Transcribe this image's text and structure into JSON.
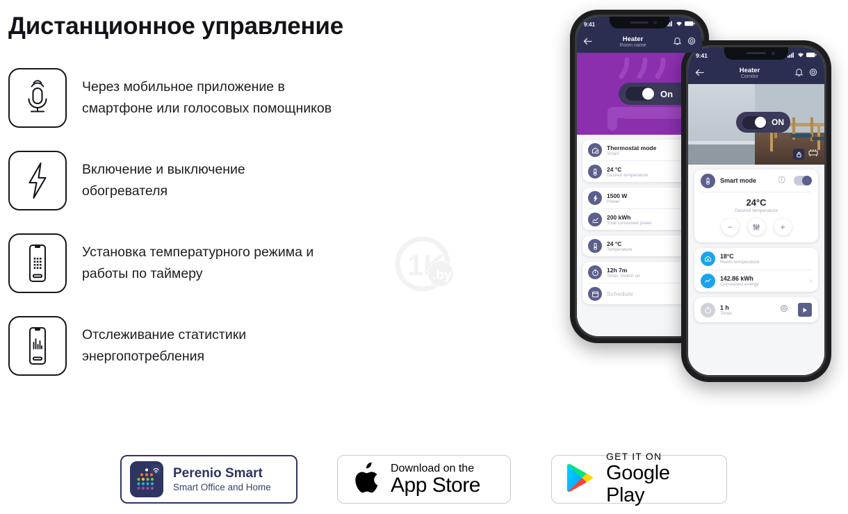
{
  "page": {
    "title": "Дистанционное управление",
    "watermark_logo": "1K.by",
    "watermark_url": "www.1k.by",
    "bg": "#ffffff"
  },
  "features": [
    {
      "icon": "microphone-icon",
      "line1": "Через мобильное приложение в",
      "line2": "смартфоне или голосовых помощников"
    },
    {
      "icon": "lightning-bolt-icon",
      "line1": "Включение и выключение",
      "line2": "обогревателя"
    },
    {
      "icon": "smartphone-keypad-icon",
      "line1": "Установка температурного режима и",
      "line2": "работы по таймеру"
    },
    {
      "icon": "smartphone-chart-icon",
      "line1": "Отслеживание статистики",
      "line2": "энергопотребления"
    }
  ],
  "phone_back": {
    "status": {
      "time": "9:41",
      "signal": "signal-bars-icon",
      "wifi": "wifi-icon",
      "battery": "battery-icon"
    },
    "appbar": {
      "back": "arrow-left-icon",
      "title": "Heater",
      "subtitle": "Room name",
      "bell": "bell-icon",
      "gear": "gear-icon"
    },
    "hero": {
      "bg_color": "#8B2FAF",
      "toggle_label": "On",
      "toggle_state": "on"
    },
    "cards": [
      {
        "rows": [
          {
            "icon": "thermostat-mode-icon",
            "value": "Thermostat mode",
            "sub": "Smart"
          },
          {
            "icon": "desired-temperature-icon",
            "value": "24 °C",
            "sub": "Desired temperature"
          }
        ]
      },
      {
        "rows": [
          {
            "icon": "power-bolt-icon",
            "value": "1500 W",
            "sub": "Power"
          },
          {
            "icon": "consumed-power-icon",
            "value": "200 kWh",
            "sub": "Total consumed power"
          }
        ]
      },
      {
        "rows": [
          {
            "icon": "thermometer-icon",
            "value": "24 °C",
            "sub": "Temperature"
          }
        ]
      },
      {
        "rows": [
          {
            "icon": "timer-icon",
            "value": "12h 7m",
            "sub": "Timer, Switch on"
          },
          {
            "icon": "schedule-icon",
            "value": "Schedule",
            "sub": ""
          }
        ]
      }
    ]
  },
  "phone_front": {
    "status": {
      "time": "9:41",
      "signal": "signal-bars-icon",
      "wifi": "wifi-icon",
      "battery": "battery-icon"
    },
    "appbar": {
      "back": "arrow-left-icon",
      "title": "Heater",
      "subtitle": "Corridor",
      "bell": "bell-icon",
      "gear": "gear-icon"
    },
    "hero": {
      "toggle_label": "ON",
      "toggle_state": "on",
      "lock_icon": "lock-icon",
      "device_icon": "heater-icon"
    },
    "smart_mode": {
      "icon": "thermometer-icon",
      "label": "Smart mode",
      "info_icon": "info-icon",
      "toggle_state": "on",
      "toggle_color": "#5b5f8c",
      "temperature": "24°C",
      "temperature_caption": "Desired temperature",
      "minus_label": "−",
      "sliders_icon": "sliders-icon",
      "plus_label": "+"
    },
    "stats": [
      {
        "icon": "home-temperature-icon",
        "icon_color": "#1aa3ea",
        "value": "18°C",
        "sub": "Room temperature",
        "chevron": ""
      },
      {
        "icon": "energy-chart-icon",
        "icon_color": "#1aa3ea",
        "value": "142.86 kWh",
        "sub": "Consumed energy",
        "chevron": "›"
      }
    ],
    "timer": {
      "icon": "timer-icon",
      "value": "1 h",
      "sub": "Timer",
      "gear_icon": "gear-icon",
      "play_icon": "play-icon"
    }
  },
  "badges": [
    {
      "name": "perenio-smart-badge",
      "title": "Perenio Smart",
      "subtitle": "Smart Office and Home",
      "icon": "perenio-app-icon",
      "border": "#2d3560",
      "title_color": "#2d3560"
    },
    {
      "name": "app-store-badge",
      "icon": "apple-logo-icon",
      "line1": "Download on the",
      "line2": "App Store",
      "border": "#c9cace"
    },
    {
      "name": "google-play-badge",
      "icon": "google-play-triangle-icon",
      "line1": "GET IT ON",
      "line2": "Google Play",
      "border": "#c9cace"
    }
  ]
}
